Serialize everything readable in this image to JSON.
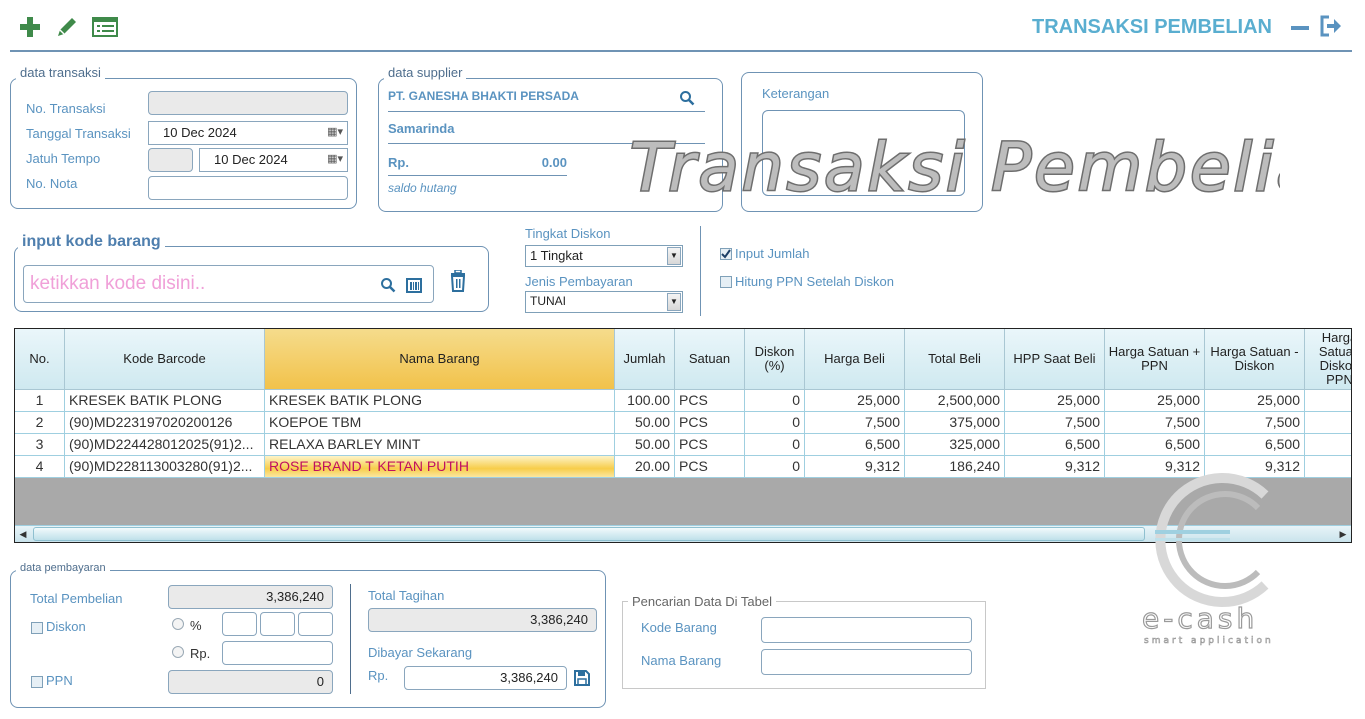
{
  "toolbar": {
    "add_icon": "plus-icon",
    "edit_icon": "pencil-icon",
    "list_icon": "list-icon"
  },
  "header": {
    "title": "TRANSAKSI PEMBELIAN",
    "minimize_icon": "minus-icon",
    "exit_icon": "exit-icon"
  },
  "watermark": {
    "text": "Transaksi Pembelian"
  },
  "transaksi": {
    "group_title": "data transaksi",
    "no_transaksi_label": "No. Transaksi",
    "no_transaksi_value": "",
    "tanggal_label": "Tanggal Transaksi",
    "tanggal_value": "10 Dec 2024",
    "jatuh_tempo_label": "Jatuh Tempo",
    "jatuh_tempo_days": "",
    "jatuh_tempo_value": "10 Dec 2024",
    "no_nota_label": "No. Nota",
    "no_nota_value": ""
  },
  "supplier": {
    "group_title": "data supplier",
    "name": "PT. GANESHA BHAKTI PERSADA",
    "city": "Samarinda",
    "rp_label": "Rp.",
    "saldo_value": "0.00",
    "saldo_label": "saldo hutang"
  },
  "keterangan": {
    "label": "Keterangan",
    "value": ""
  },
  "input_kode": {
    "group_title": "input kode barang",
    "placeholder": "ketikkan kode disini.."
  },
  "options": {
    "tingkat_label": "Tingkat Diskon",
    "tingkat_value": "1 Tingkat",
    "jenis_label": "Jenis Pembayaran",
    "jenis_value": "TUNAI",
    "input_jumlah_label": "Input Jumlah",
    "input_jumlah_checked": true,
    "hitung_ppn_label": "Hitung PPN Setelah Diskon",
    "hitung_ppn_checked": false
  },
  "table": {
    "columns": [
      "No.",
      "Kode Barcode",
      "Nama Barang",
      "Jumlah",
      "Satuan",
      "Diskon (%)",
      "Harga Beli",
      "Total Beli",
      "HPP Saat Beli",
      "Harga Satuan + PPN",
      "Harga Satuan - Diskon",
      "Harga Satuan Diskon PPN"
    ],
    "rows": [
      [
        "1",
        "KRESEK BATIK PLONG",
        "KRESEK BATIK PLONG",
        "100.00",
        "PCS",
        "0",
        "25,000",
        "2,500,000",
        "25,000",
        "25,000",
        "25,000"
      ],
      [
        "2",
        "(90)MD223197020200126",
        "KOEPOE TBM",
        "50.00",
        "PCS",
        "0",
        "7,500",
        "375,000",
        "7,500",
        "7,500",
        "7,500"
      ],
      [
        "3",
        "(90)MD224428012025(91)2...",
        "RELAXA BARLEY MINT",
        "50.00",
        "PCS",
        "0",
        "6,500",
        "325,000",
        "6,500",
        "6,500",
        "6,500"
      ],
      [
        "4",
        "(90)MD228113003280(91)2...",
        "ROSE BRAND T KETAN PUTIH",
        "20.00",
        "PCS",
        "0",
        "9,312",
        "186,240",
        "9,312",
        "9,312",
        "9,312"
      ]
    ]
  },
  "pembayaran": {
    "group_title": "data pembayaran",
    "total_pembelian_label": "Total Pembelian",
    "total_pembelian_value": "3,386,240",
    "diskon_label": "Diskon",
    "percent_label": "%",
    "rp_label": "Rp.",
    "ppn_label": "PPN",
    "ppn_value": "0",
    "total_tagihan_label": "Total Tagihan",
    "total_tagihan_value": "3,386,240",
    "dibayar_label": "Dibayar Sekarang",
    "dibayar_rp_label": "Rp.",
    "dibayar_value": "3,386,240"
  },
  "pencarian": {
    "group_title": "Pencarian Data Di Tabel",
    "kode_label": "Kode Barang",
    "nama_label": "Nama Barang"
  },
  "logo": {
    "text": "e-cash",
    "tagline": "smart application"
  },
  "colors": {
    "accent": "#5aaed0",
    "label": "#5a93c0",
    "green_icon": "#3f8a4a",
    "highlight": "#f2c24a",
    "selected_text": "#c01060"
  }
}
